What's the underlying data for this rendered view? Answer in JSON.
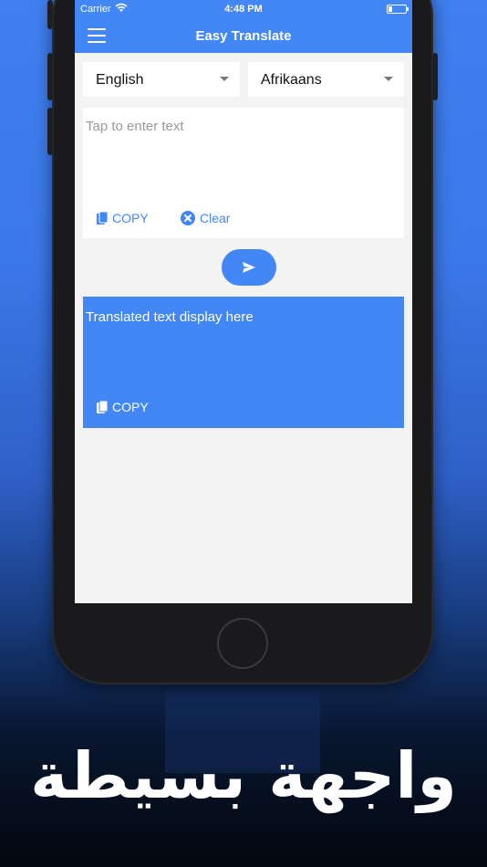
{
  "status_bar": {
    "carrier": "Carrier",
    "time": "4:48 PM",
    "battery_level": 0.2
  },
  "nav": {
    "title": "Easy Translate",
    "menu_icon": "hamburger-icon"
  },
  "languages": {
    "source": "English",
    "target": "Afrikaans"
  },
  "input": {
    "placeholder": "Tap to enter text",
    "copy_label": "COPY",
    "clear_label": "Clear"
  },
  "send": {
    "icon": "send-icon"
  },
  "output": {
    "text": "Translated text display here",
    "copy_label": "COPY"
  },
  "caption": "واجهة بسيطة",
  "colors": {
    "accent": "#4287f5",
    "screen_bg": "#f3f3f3",
    "placeholder": "#999999"
  }
}
